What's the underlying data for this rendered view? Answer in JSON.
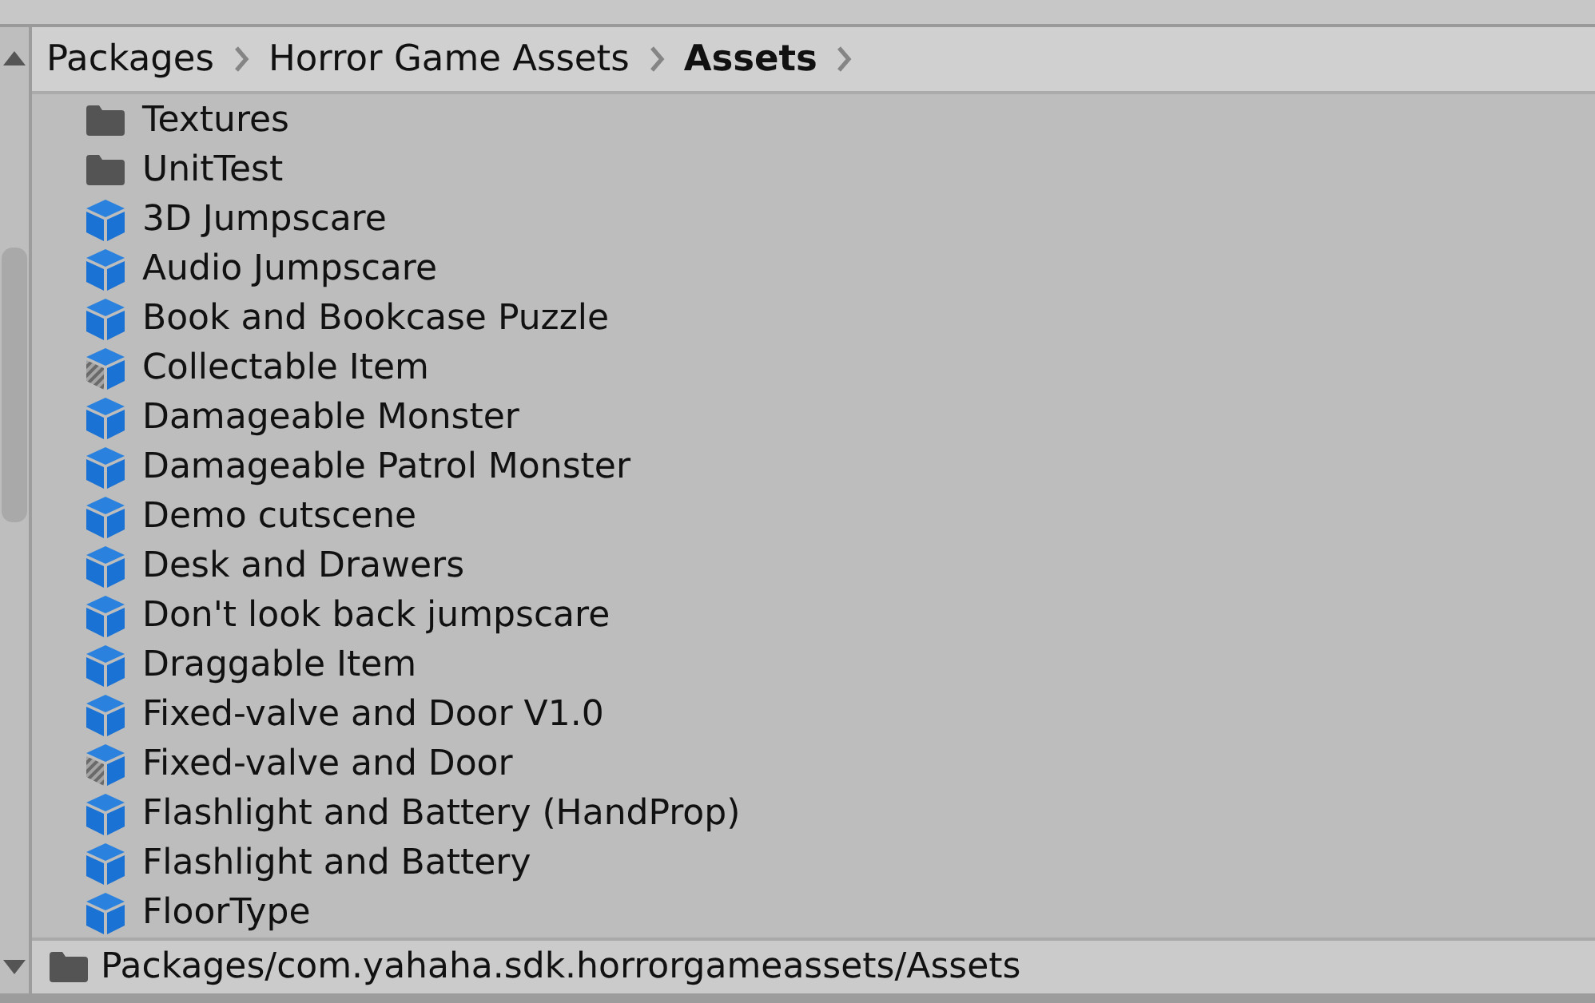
{
  "breadcrumb": [
    {
      "label": "Packages",
      "current": false
    },
    {
      "label": "Horror Game Assets",
      "current": false
    },
    {
      "label": "Assets",
      "current": true
    }
  ],
  "items": [
    {
      "name": "Textures",
      "kind": "folder"
    },
    {
      "name": "UnitTest",
      "kind": "folder"
    },
    {
      "name": "3D Jumpscare",
      "kind": "prefab"
    },
    {
      "name": "Audio Jumpscare",
      "kind": "prefab"
    },
    {
      "name": "Book and Bookcase Puzzle",
      "kind": "prefab"
    },
    {
      "name": "Collectable Item",
      "kind": "variant"
    },
    {
      "name": "Damageable Monster",
      "kind": "prefab"
    },
    {
      "name": "Damageable Patrol Monster",
      "kind": "prefab"
    },
    {
      "name": "Demo cutscene",
      "kind": "prefab"
    },
    {
      "name": "Desk and Drawers",
      "kind": "prefab"
    },
    {
      "name": "Don't look back jumpscare",
      "kind": "prefab"
    },
    {
      "name": "Draggable Item",
      "kind": "prefab"
    },
    {
      "name": "Fixed-valve and Door V1.0",
      "kind": "prefab"
    },
    {
      "name": "Fixed-valve and Door",
      "kind": "variant"
    },
    {
      "name": "Flashlight and Battery (HandProp)",
      "kind": "prefab"
    },
    {
      "name": "Flashlight and Battery",
      "kind": "prefab"
    },
    {
      "name": "FloorType",
      "kind": "prefab"
    }
  ],
  "status_bar": {
    "path": "Packages/com.yahaha.sdk.horrorgameassets/Assets"
  }
}
